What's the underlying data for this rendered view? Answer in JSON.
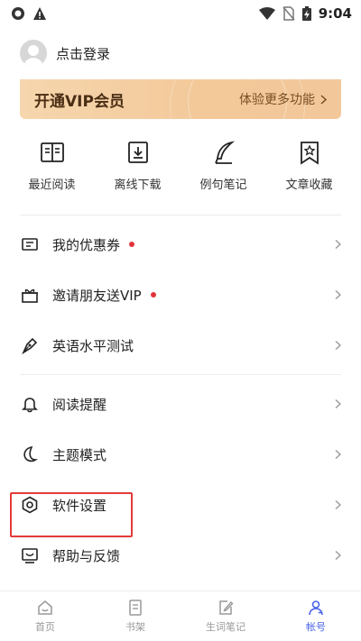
{
  "status_bar": {
    "time": "9:04",
    "icons": [
      "circle-notification-icon",
      "warning-icon",
      "wifi-icon",
      "no-sim-icon",
      "battery-charging-icon"
    ]
  },
  "profile": {
    "login_label": "点击登录"
  },
  "vip": {
    "title": "开通VIP会员",
    "more_label": "体验更多功能",
    "colors": {
      "from": "#f6d6ae",
      "to": "#f2c89b"
    }
  },
  "quick_actions": [
    {
      "label": "最近阅读",
      "icon": "book-open-icon"
    },
    {
      "label": "离线下载",
      "icon": "download-icon"
    },
    {
      "label": "例句笔记",
      "icon": "feather-pen-icon"
    },
    {
      "label": "文章收藏",
      "icon": "bookmark-star-icon"
    }
  ],
  "menu": {
    "group1": [
      {
        "label": "我的优惠券",
        "icon": "coupon-icon",
        "dot": true
      },
      {
        "label": "邀请朋友送VIP",
        "icon": "gift-icon",
        "dot": true
      },
      {
        "label": "英语水平测试",
        "icon": "pen-nib-icon",
        "dot": false
      }
    ],
    "group2": [
      {
        "label": "阅读提醒",
        "icon": "bell-icon"
      },
      {
        "label": "主题模式",
        "icon": "moon-icon"
      },
      {
        "label": "软件设置",
        "icon": "settings-icon"
      },
      {
        "label": "帮助与反馈",
        "icon": "feedback-icon"
      }
    ]
  },
  "tabbar": {
    "tabs": [
      {
        "label": "首页",
        "icon": "home-icon",
        "active": false
      },
      {
        "label": "书架",
        "icon": "bookshelf-icon",
        "active": false
      },
      {
        "label": "生词笔记",
        "icon": "edit-note-icon",
        "active": false
      },
      {
        "label": "帐号",
        "icon": "account-icon",
        "active": true
      }
    ],
    "active_color": "#4a64e8"
  },
  "highlight_color": "#e23a3a"
}
